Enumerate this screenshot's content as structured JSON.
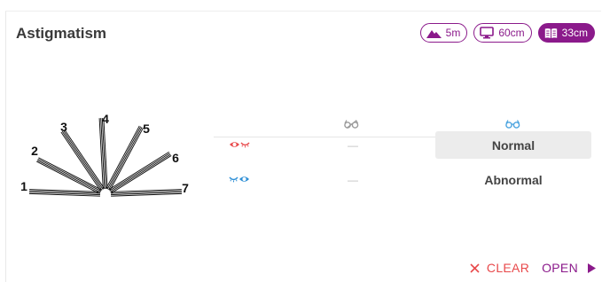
{
  "card": {
    "title": "Astigmatism"
  },
  "distances": [
    {
      "label": "5m",
      "icon": "mountain-icon",
      "active": false
    },
    {
      "label": "60cm",
      "icon": "monitor-icon",
      "active": false
    },
    {
      "label": "33cm",
      "icon": "book-icon",
      "active": true
    }
  ],
  "dial": {
    "numbers": [
      "1",
      "2",
      "3",
      "4",
      "5",
      "6",
      "7"
    ]
  },
  "table": {
    "columns": [
      {
        "icon": "glasses-off-icon",
        "color": "#9a9a9a"
      },
      {
        "icon": "glasses-on-icon",
        "color": "#4aa3df"
      }
    ],
    "rows": [
      {
        "eye_icon": "right-eye-open-icon",
        "eye_color": "#e8494b",
        "without_glasses": "—",
        "with_glasses": "Normal",
        "selected": true
      },
      {
        "eye_icon": "left-eye-open-icon",
        "eye_color": "#2e8fd6",
        "without_glasses": "—",
        "with_glasses": "Abnormal",
        "selected": false
      }
    ]
  },
  "actions": {
    "clear_label": "CLEAR",
    "open_label": "OPEN",
    "clear_color": "#e8494b",
    "open_color": "#8b1a8b"
  },
  "accent_color": "#8b1a8b"
}
